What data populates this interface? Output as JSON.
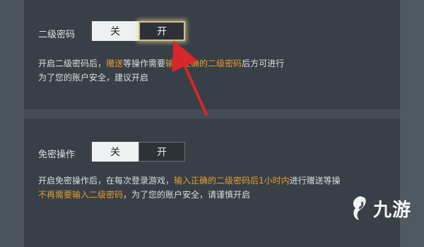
{
  "section1": {
    "label": "二级密码",
    "toggle": {
      "off_label": "关",
      "on_label": "开",
      "selected": "on"
    },
    "desc_line1": {
      "p1": "开启二级密码后，",
      "h1": "赠送",
      "p2": "等操作需要",
      "h2": "输入正确的二级密码",
      "p3": "后方可进行"
    },
    "desc_line2": "为了您的账户安全，建议开启"
  },
  "section2": {
    "label": "免密操作",
    "toggle": {
      "off_label": "关",
      "on_label": "开",
      "selected": "off"
    },
    "desc_line1": {
      "p1": "开启免密操作后，在每次登录游戏，",
      "h1": "输入正确的二级密码后1小时内",
      "p2": "进行赠送等操"
    },
    "desc_line2": {
      "h1": "不再需要输入二级密码",
      "p1": "，为了您的账户安全，请谨慎开启"
    }
  },
  "watermark": {
    "text": "九游"
  },
  "colors": {
    "highlight": "#e89b2e",
    "arrow": "#d8262b",
    "glow": "#cfc28a"
  }
}
